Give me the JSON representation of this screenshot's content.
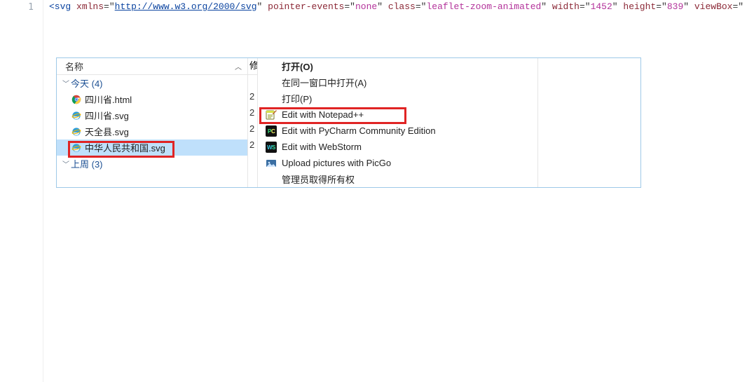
{
  "code": {
    "line_number": "1",
    "tag_open": "<svg",
    "attrs": [
      {
        "name": "xmlns",
        "value": "http://www.w3.org/2000/svg",
        "is_url": true
      },
      {
        "name": "pointer-events",
        "value": "none"
      },
      {
        "name": "class",
        "value": "leaflet-zoom-animated"
      },
      {
        "name": "width",
        "value": "1452"
      },
      {
        "name": "height",
        "value": "839"
      },
      {
        "name": "viewBox",
        "value": "",
        "truncated": true
      }
    ]
  },
  "explorer": {
    "columns": {
      "name": "名称",
      "sort_indicator": "︿",
      "date_partial": "修"
    },
    "groups": [
      {
        "label": "今天",
        "count_suffix": "(4)"
      },
      {
        "label": "上周",
        "count_suffix": "(3)"
      }
    ],
    "today_files": [
      {
        "icon": "chrome",
        "name": "四川省.html",
        "date_partial": "2"
      },
      {
        "icon": "ie-svg",
        "name": "四川省.svg",
        "date_partial": "2"
      },
      {
        "icon": "ie-svg",
        "name": "天全县.svg",
        "date_partial": "2"
      },
      {
        "icon": "ie-svg",
        "name": "中华人民共和国.svg",
        "date_partial": "2",
        "selected": true,
        "highlighted": true
      }
    ]
  },
  "context_menu": {
    "items": [
      {
        "icon": null,
        "label": "打开(O)"
      },
      {
        "icon": null,
        "label": "在同一窗口中打开(A)"
      },
      {
        "icon": null,
        "label": "打印(P)"
      },
      {
        "icon": "notepadpp",
        "label": "Edit with Notepad++",
        "highlighted": true
      },
      {
        "icon": "pycharm",
        "label": "Edit with PyCharm Community Edition"
      },
      {
        "icon": "webstorm",
        "label": "Edit with WebStorm"
      },
      {
        "icon": "picgo",
        "label": "Upload pictures with PicGo"
      },
      {
        "icon": null,
        "label": "管理员取得所有权"
      }
    ]
  },
  "highlight_color": "#e02424"
}
